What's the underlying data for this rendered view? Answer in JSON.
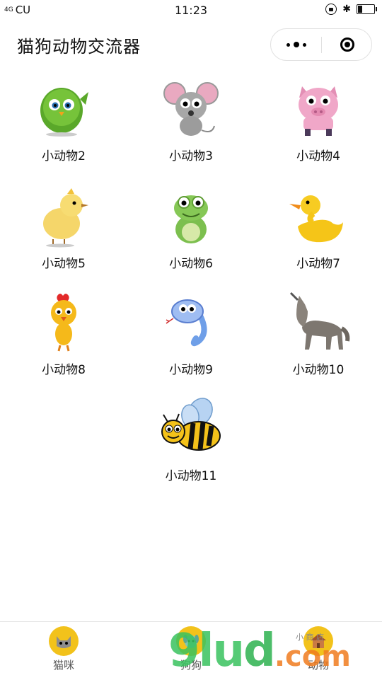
{
  "status_bar": {
    "signal": "4G",
    "carrier": "CU",
    "time": "11:23",
    "battery_level": 0.3
  },
  "header": {
    "title": "猫狗动物交流器"
  },
  "animals": [
    {
      "label": "小动物2",
      "icon": "green-bird-icon"
    },
    {
      "label": "小动物3",
      "icon": "mouse-icon"
    },
    {
      "label": "小动物4",
      "icon": "pig-icon"
    },
    {
      "label": "小动物5",
      "icon": "chick-icon"
    },
    {
      "label": "小动物6",
      "icon": "frog-icon"
    },
    {
      "label": "小动物7",
      "icon": "duck-icon"
    },
    {
      "label": "小动物8",
      "icon": "rooster-icon"
    },
    {
      "label": "小动物9",
      "icon": "snake-icon"
    },
    {
      "label": "小动物10",
      "icon": "wolf-icon"
    },
    {
      "label": "小动物11",
      "icon": "bee-icon"
    }
  ],
  "tabbar": [
    {
      "label": "猫咪",
      "icon": "cat-icon"
    },
    {
      "label": "狗狗",
      "icon": "dog-icon"
    },
    {
      "label": "动物",
      "icon": "animal-house-icon"
    }
  ],
  "watermark": {
    "part1": "9lu",
    "part2": "d",
    "part3": ".com",
    "note": "小 商 店"
  },
  "colors": {
    "tab_icon_bg": "#f2c21b",
    "watermark_green": "#39c25f",
    "watermark_orange": "#f07c1f"
  }
}
